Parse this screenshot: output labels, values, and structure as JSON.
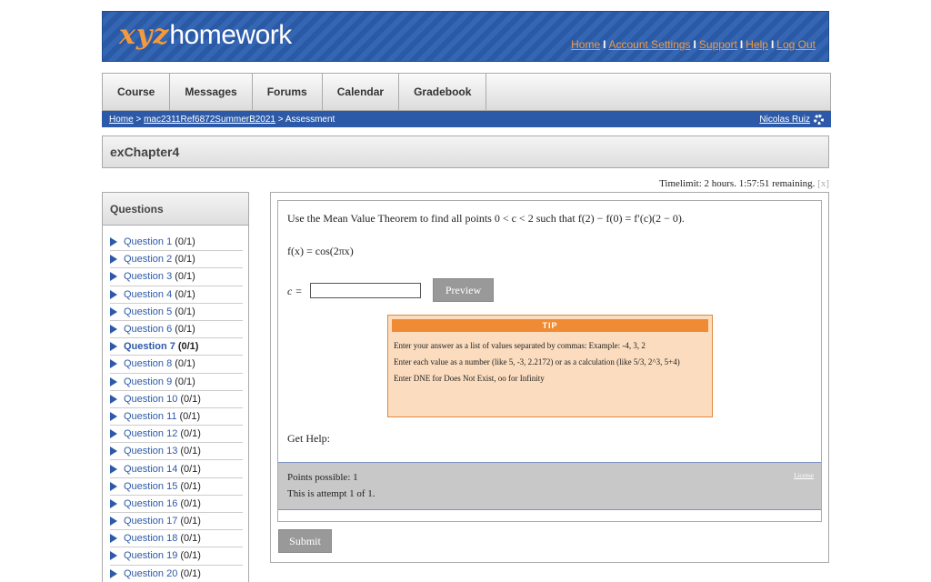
{
  "header": {
    "logo_xyz": "xyz",
    "logo_homework": "homework",
    "links": [
      "Home",
      "Account Settings",
      "Support",
      "Help",
      "Log Out"
    ],
    "separator": "I"
  },
  "nav": {
    "tabs": [
      "Course",
      "Messages",
      "Forums",
      "Calendar",
      "Gradebook"
    ]
  },
  "breadcrumb": {
    "home": "Home",
    "sep1": ">",
    "course": "mac2311Ref6872SummerB2021",
    "sep2": "> Assessment",
    "user": "Nicolas Ruiz"
  },
  "page_title": "exChapter4",
  "timelimit": {
    "text": "Timelimit: 2 hours. 1:57:51 remaining.",
    "close": "[x]"
  },
  "sidebar": {
    "heading": "Questions",
    "items": [
      {
        "label": "Question 1",
        "score": "(0/1)"
      },
      {
        "label": "Question 2",
        "score": "(0/1)"
      },
      {
        "label": "Question 3",
        "score": "(0/1)"
      },
      {
        "label": "Question 4",
        "score": "(0/1)"
      },
      {
        "label": "Question 5",
        "score": "(0/1)"
      },
      {
        "label": "Question 6",
        "score": "(0/1)"
      },
      {
        "label": "Question 7",
        "score": "(0/1)"
      },
      {
        "label": "Question 8",
        "score": "(0/1)"
      },
      {
        "label": "Question 9",
        "score": "(0/1)"
      },
      {
        "label": "Question 10",
        "score": "(0/1)"
      },
      {
        "label": "Question 11",
        "score": "(0/1)"
      },
      {
        "label": "Question 12",
        "score": "(0/1)"
      },
      {
        "label": "Question 13",
        "score": "(0/1)"
      },
      {
        "label": "Question 14",
        "score": "(0/1)"
      },
      {
        "label": "Question 15",
        "score": "(0/1)"
      },
      {
        "label": "Question 16",
        "score": "(0/1)"
      },
      {
        "label": "Question 17",
        "score": "(0/1)"
      },
      {
        "label": "Question 18",
        "score": "(0/1)"
      },
      {
        "label": "Question 19",
        "score": "(0/1)"
      },
      {
        "label": "Question 20",
        "score": "(0/1)"
      }
    ]
  },
  "question": {
    "prompt": "Use the Mean Value Theorem to find all points 0 < c < 2 such that f(2) − f(0) = f′(c)(2 − 0).",
    "function": "f(x) = cos(2πx)",
    "answer_label": "c =",
    "answer_value": "",
    "preview_label": "Preview",
    "tip": {
      "heading": "TIP",
      "line1": "Enter your answer as a list of values separated by commas: Example: -4, 3, 2",
      "line2": "Enter each value as a number (like 5, -3, 2.2172) or as a calculation (like 5/3, 2^3, 5+4)",
      "line3": "Enter DNE for Does Not Exist, oo for Infinity"
    },
    "get_help": "Get Help:",
    "points_possible": "Points possible: 1",
    "attempt": "This is attempt 1 of 1.",
    "license": "License"
  },
  "submit_label": "Submit",
  "colors": {
    "header_blue": "#2a5aa6",
    "accent_orange": "#f39a3c",
    "link_blue": "#2d5aa8",
    "tip_bg": "#fbdcbf"
  },
  "icons": {
    "user": "gear-icon",
    "question_marker": "triangle-right-icon"
  }
}
